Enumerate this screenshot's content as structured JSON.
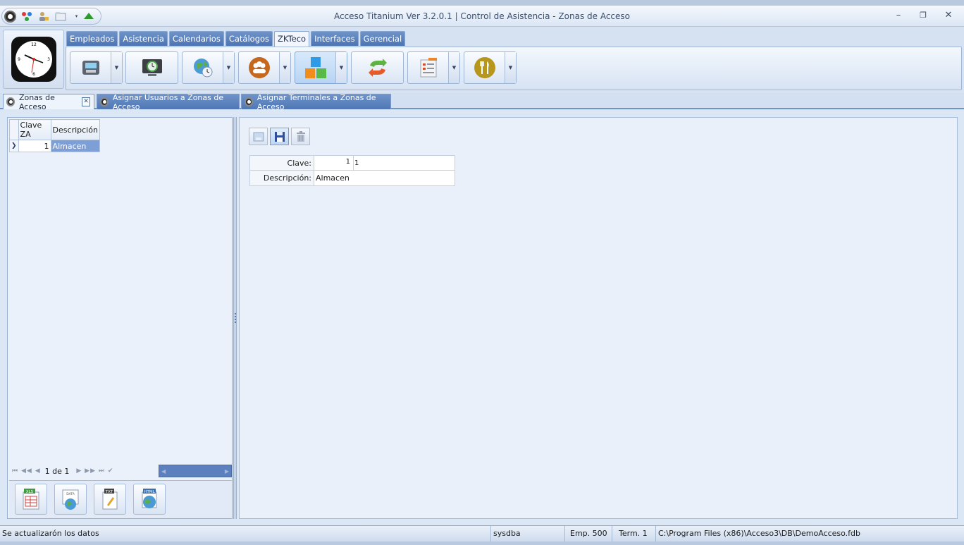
{
  "window": {
    "title": "Acceso Titanium  Ver 3.2.0.1 | Control de Asistencia - Zonas de Acceso",
    "minimize": "–",
    "restore": "❐",
    "close": "✕"
  },
  "ribbon": {
    "tabs": [
      "Empleados",
      "Asistencia",
      "Calendarios",
      "Catálogos",
      "ZKTeco",
      "Interfaces",
      "Gerencial"
    ],
    "active_tab": "ZKTeco",
    "buttons": [
      {
        "icon": "fingerprint-terminal-icon",
        "dropdown": true
      },
      {
        "icon": "history-monitor-icon",
        "dropdown": false
      },
      {
        "icon": "globe-clock-icon",
        "dropdown": true
      },
      {
        "icon": "users-group-icon",
        "dropdown": true
      },
      {
        "icon": "access-zones-blocks-icon",
        "dropdown": true
      },
      {
        "icon": "sync-arrows-icon",
        "dropdown": false
      },
      {
        "icon": "report-list-icon",
        "dropdown": true
      },
      {
        "icon": "dining-fork-knife-icon",
        "dropdown": true
      }
    ]
  },
  "doc_tabs": {
    "items": [
      "Zonas de Acceso",
      "Asignar Usuarios a Zonas de Acceso",
      "Asignar Terminales a Zonas de Acceso"
    ],
    "close_label": "✕"
  },
  "grid": {
    "columns": [
      "Clave ZA",
      "Descripción"
    ],
    "rows": [
      {
        "indicator": "❯",
        "clave": "1",
        "descripcion": "Almacen"
      }
    ]
  },
  "navigator": {
    "page_label": "1 de 1",
    "first": "⏮",
    "prev_page": "◀◀",
    "prev": "◀",
    "next": "▶",
    "next_page": "▶▶",
    "last": "⏭",
    "confirm": "✔"
  },
  "export_buttons": [
    "XLS",
    "DATA",
    "TXT",
    "HTML"
  ],
  "toolbar": {
    "new": "new-record-icon",
    "save": "save-disk-icon",
    "delete": "delete-trash-icon"
  },
  "form": {
    "clave_label": "Clave:",
    "clave_value": "1",
    "clave_echo": "1",
    "descripcion_label": "Descripción:",
    "descripcion_value": "Almacen"
  },
  "status": {
    "message": "Se actualizarón los datos",
    "user": "sysdba",
    "empresa": "Emp. 500",
    "terminal": "Term. 1",
    "db_path": "C:\\Program Files (x86)\\Acceso3\\DB\\DemoAcceso.fdb"
  },
  "colors": {
    "accent": "#4d75b4",
    "selection": "#7e9fd6",
    "background": "#dce7f5"
  }
}
